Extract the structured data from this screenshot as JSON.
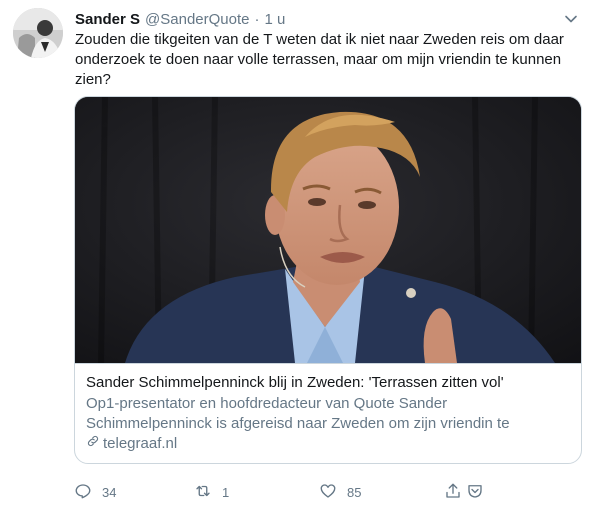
{
  "tweet": {
    "author_name": "Sander S",
    "author_handle": "@SanderQuote",
    "separator": "·",
    "timestamp": "1 u",
    "text": "Zouden die tikgeiten van de T weten dat ik niet naar Zweden reis om daar onderzoek te doen naar volle terrassen, maar om mijn vriendin te kunnen zien?"
  },
  "card": {
    "title": "Sander Schimmelpenninck blij in Zweden: 'Terrassen zitten vol'",
    "description": "Op1-presentator en hoofdredacteur van Quote Sander Schimmelpenninck is afgereisd naar Zweden om zijn vriendin te kunnen...",
    "domain": "telegraaf.nl"
  },
  "actions": {
    "reply_count": "34",
    "retweet_count": "1",
    "like_count": "85"
  },
  "icons": {
    "reply": "reply-icon",
    "retweet": "retweet-icon",
    "like": "heart-icon",
    "share": "share-icon",
    "caret": "chevron-down-icon",
    "link": "link-icon"
  },
  "colors": {
    "text": "#14171a",
    "secondary": "#657786",
    "border": "#ccd6dd"
  }
}
